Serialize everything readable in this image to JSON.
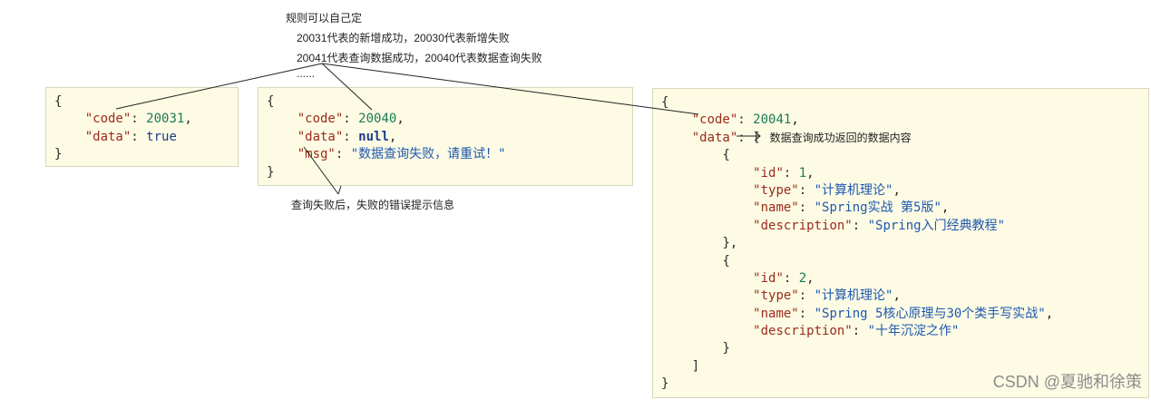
{
  "top_note": {
    "line1": "规则可以自己定",
    "line2": "20031代表的新增成功，20030代表新增失败",
    "line3": "20041代表查询数据成功，20040代表数据查询失败",
    "line4": "......"
  },
  "box1": {
    "open": "{",
    "code_key": "\"code\"",
    "code_val": "20031",
    "data_key": "\"data\"",
    "data_val": "true",
    "close": "}"
  },
  "box2": {
    "open": "{",
    "code_key": "\"code\"",
    "code_val": "20040",
    "data_key": "\"data\"",
    "data_val": "null",
    "msg_key": "\"msg\"",
    "msg_val": "\"数据查询失败，请重试！\"",
    "close": "}"
  },
  "box2_note": "查询失败后，失败的错误提示信息",
  "box3": {
    "open": "{",
    "code_key": "\"code\"",
    "code_val": "20041",
    "data_key": "\"data\"",
    "data_note": "数据查询成功返回的数据内容",
    "items": [
      {
        "id_key": "\"id\"",
        "id_val": "1",
        "type_key": "\"type\"",
        "type_val": "\"计算机理论\"",
        "name_key": "\"name\"",
        "name_val": "\"Spring实战 第5版\"",
        "desc_key": "\"description\"",
        "desc_val": "\"Spring入门经典教程\""
      },
      {
        "id_key": "\"id\"",
        "id_val": "2",
        "type_key": "\"type\"",
        "type_val": "\"计算机理论\"",
        "name_key": "\"name\"",
        "name_val": "\"Spring 5核心原理与30个类手写实战\"",
        "desc_key": "\"description\"",
        "desc_val": "\"十年沉淀之作\""
      }
    ],
    "close_bracket": "]",
    "close": "}"
  },
  "watermark": "CSDN @夏驰和徐策"
}
